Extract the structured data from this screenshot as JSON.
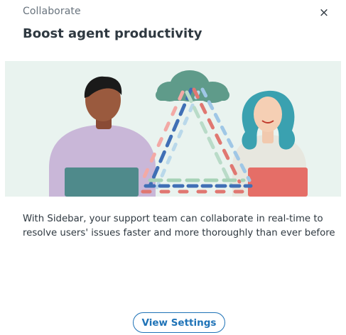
{
  "modal": {
    "eyebrow": "Collaborate",
    "close_icon": "close-icon",
    "close_glyph": "×",
    "title": "Boost agent productivity",
    "illustration": {
      "logo_glyph_left": "",
      "logo_glyph_right": ""
    },
    "description": "With Sidebar, your support team can collaborate in real-time to resolve users' issues faster and more thoroughly than ever before",
    "cta_label": "View Settings"
  },
  "colors": {
    "accent": "#1f73b7",
    "text": "#2f3941",
    "muted": "#68737d",
    "illustration_bg": "#e9f3ef"
  }
}
